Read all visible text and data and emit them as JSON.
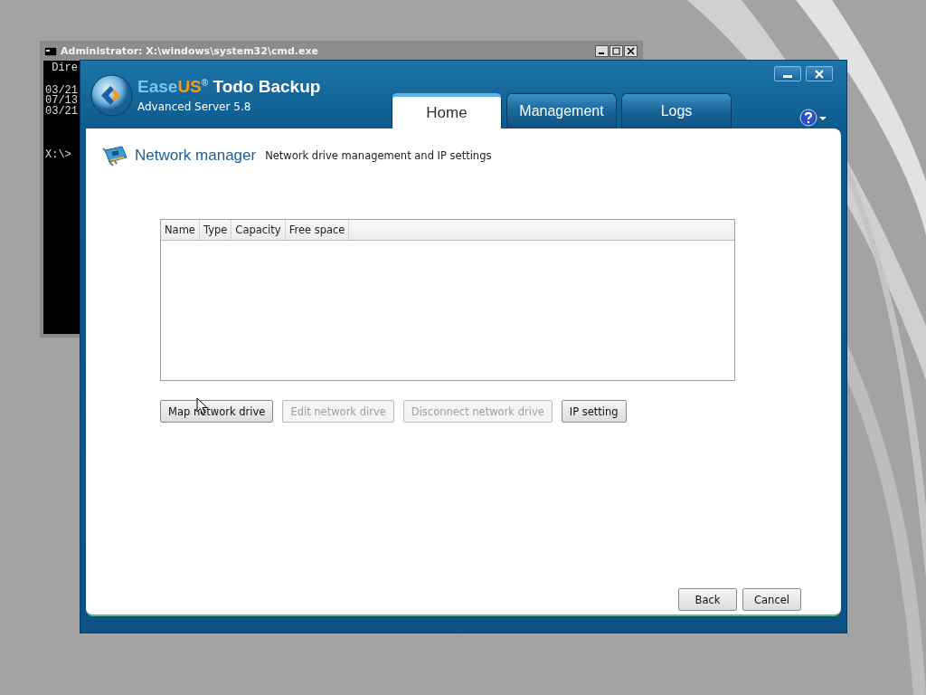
{
  "console_window": {
    "title": "Administrator: X:\\windows\\system32\\cmd.exe",
    "lines": [
      " Dire",
      "03/21",
      "07/13",
      "03/21",
      "X:\\>"
    ]
  },
  "app_window": {
    "brand_a": "Ease",
    "brand_b": "US$^{®}$",
    "product": "Todo Backup",
    "edition": "Advanced Server 5.8",
    "tabs": [
      {
        "label": "Home",
        "selected": true
      },
      {
        "label": "Management",
        "selected": false
      },
      {
        "label": "Logs",
        "selected": false
      }
    ],
    "page": {
      "title": "Network manager",
      "subtitle": "Network drive management and IP settings",
      "table": {
        "columns": [
          "Name",
          "Type",
          "Capacity",
          "Free space"
        ]
      },
      "actions": [
        {
          "label": "Map network drive",
          "disabled": false
        },
        {
          "label": "Edit network dirve",
          "disabled": true
        },
        {
          "label": "Disconnect network drive",
          "disabled": true
        },
        {
          "label": "IP setting",
          "disabled": false
        }
      ],
      "footer_buttons": [
        {
          "label": "Back",
          "disabled": false
        },
        {
          "label": "Cancel",
          "disabled": false
        }
      ]
    }
  }
}
